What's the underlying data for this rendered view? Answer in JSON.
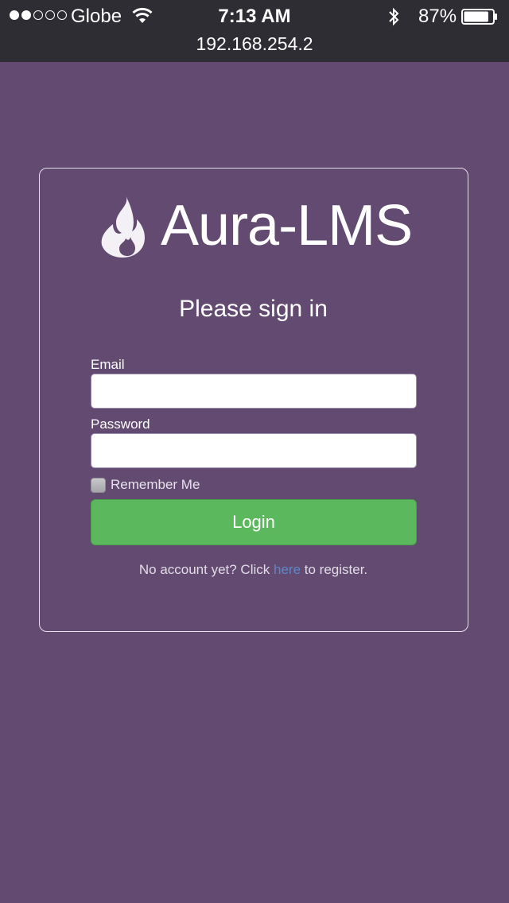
{
  "status_bar": {
    "carrier": "Globe",
    "time": "7:13 AM",
    "battery_percent": "87%",
    "battery_level": 0.87,
    "signal_strength": 2,
    "signal_max": 5
  },
  "address_bar": {
    "url": "192.168.254.2"
  },
  "brand": {
    "name": "Aura-LMS",
    "icon": "flame-icon"
  },
  "login_form": {
    "heading": "Please sign in",
    "email_label": "Email",
    "email_value": "",
    "password_label": "Password",
    "password_value": "",
    "remember_label": "Remember Me",
    "remember_checked": false,
    "login_label": "Login",
    "register_prefix": "No account yet? Click",
    "register_link": "here",
    "register_suffix": "to register."
  },
  "colors": {
    "background": "#624a71",
    "status_bar": "#2d2d33",
    "login_button": "#5cb85c",
    "link": "#5f87c7"
  }
}
